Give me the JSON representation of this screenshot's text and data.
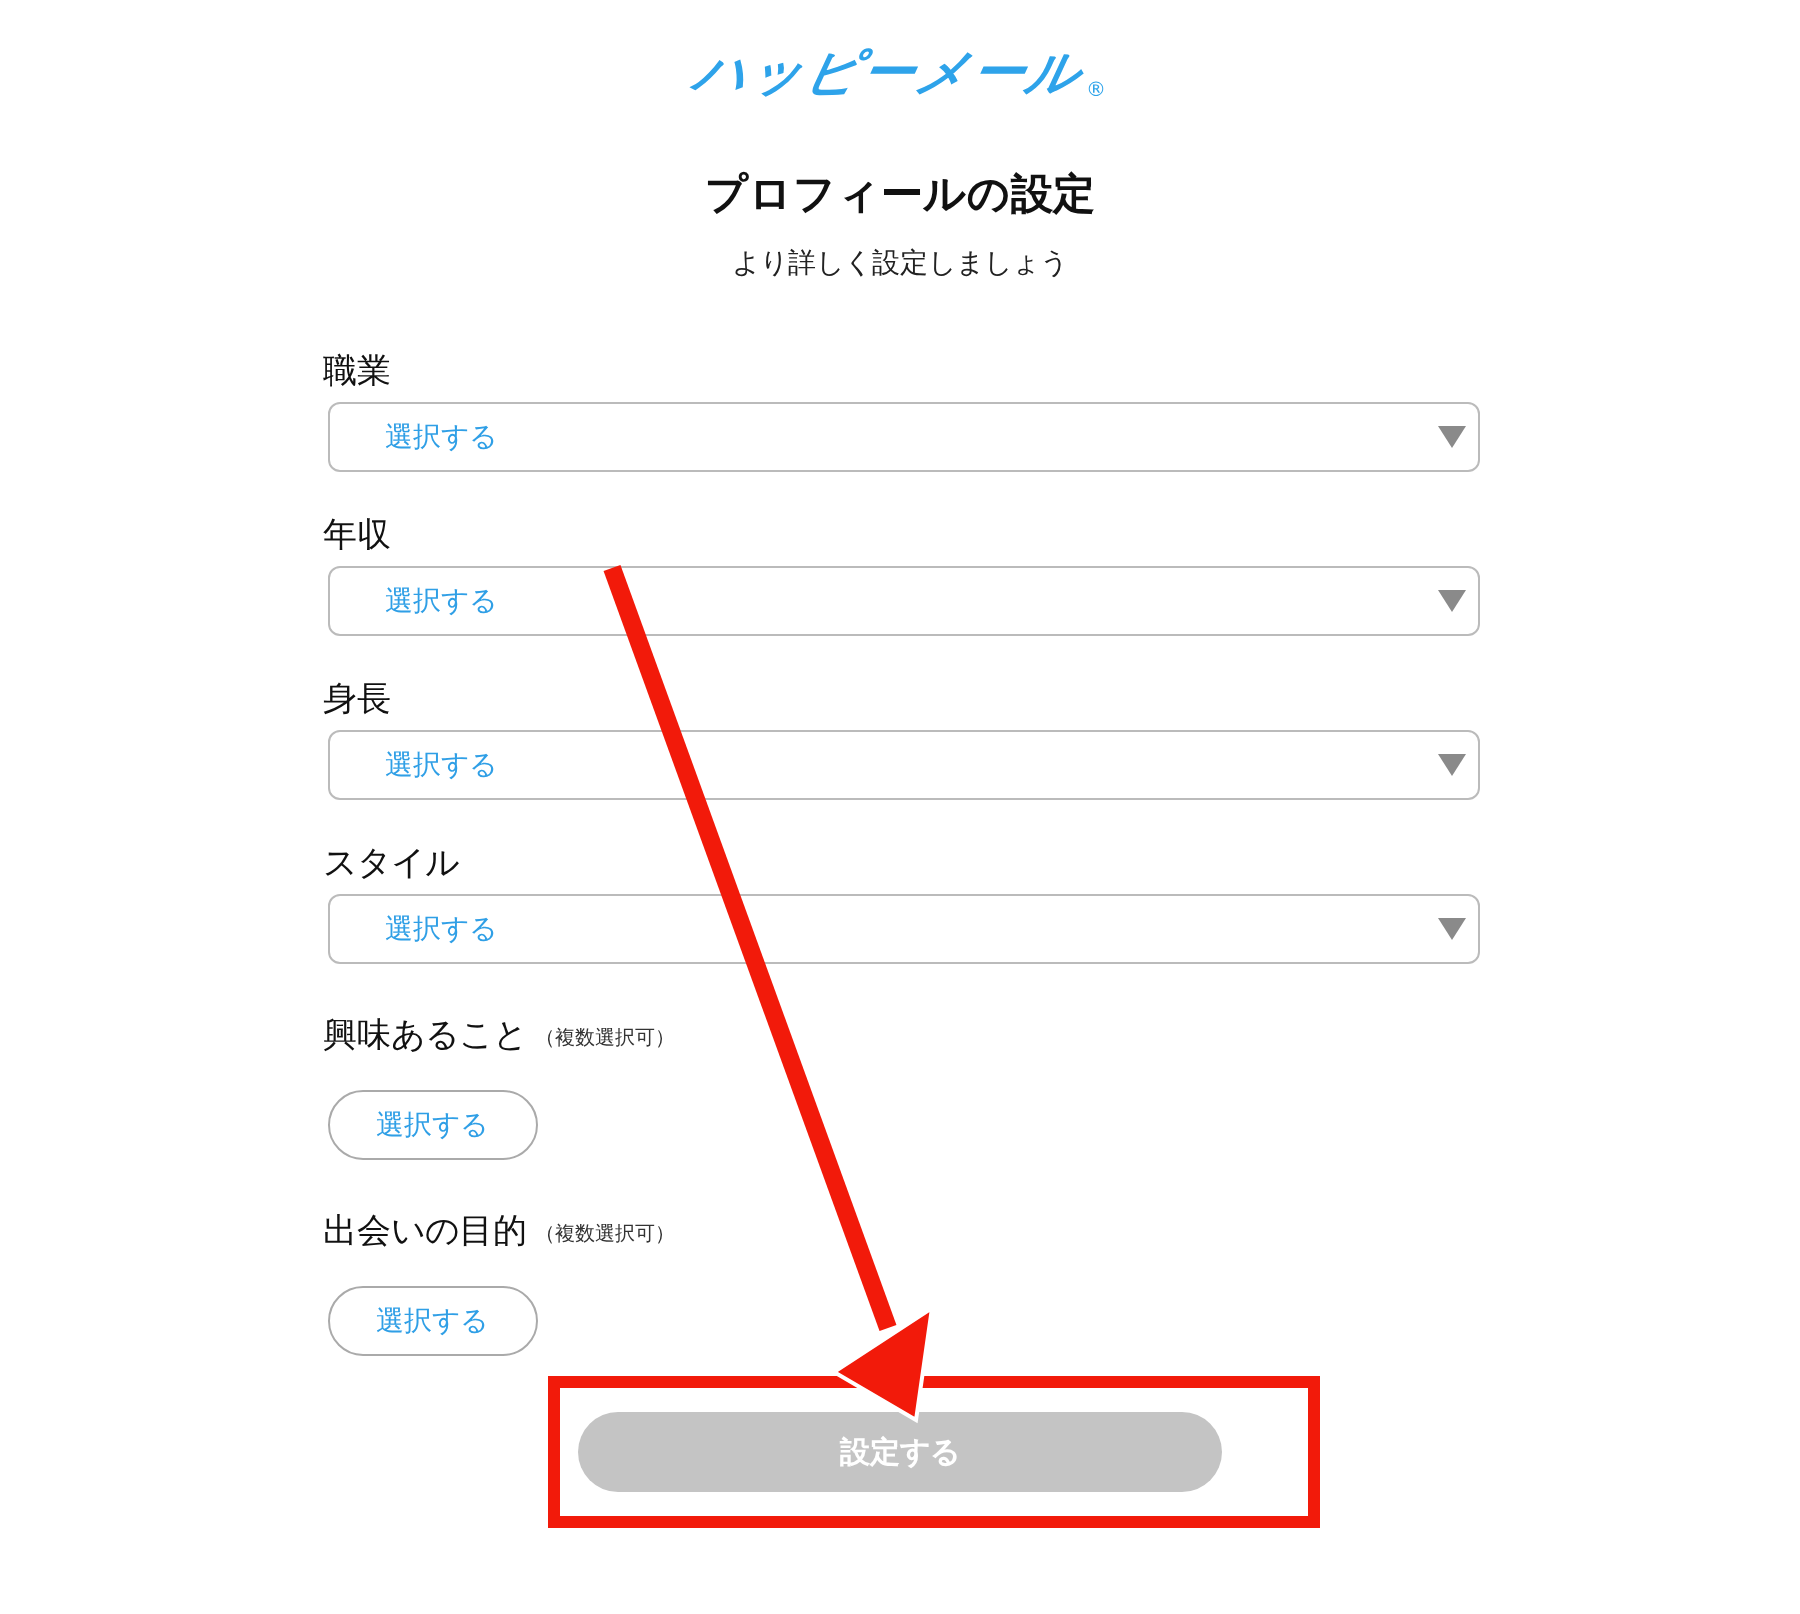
{
  "logo": {
    "text": "ハッピーメール",
    "mark": "®"
  },
  "title": "プロフィールの設定",
  "subtitle": "より詳しく設定しましょう",
  "fields": [
    {
      "kind": "select",
      "label": "職業",
      "value": "選択する"
    },
    {
      "kind": "select",
      "label": "年収",
      "value": "選択する"
    },
    {
      "kind": "select",
      "label": "身長",
      "value": "選択する"
    },
    {
      "kind": "select",
      "label": "スタイル",
      "value": "選択する"
    },
    {
      "kind": "multi",
      "label": "興味あること",
      "note": "（複数選択可）",
      "value": "選択する"
    },
    {
      "kind": "multi",
      "label": "出会いの目的",
      "note": "（複数選択可）",
      "value": "選択する"
    }
  ],
  "submit": {
    "label": "設定する",
    "disabled": true
  }
}
